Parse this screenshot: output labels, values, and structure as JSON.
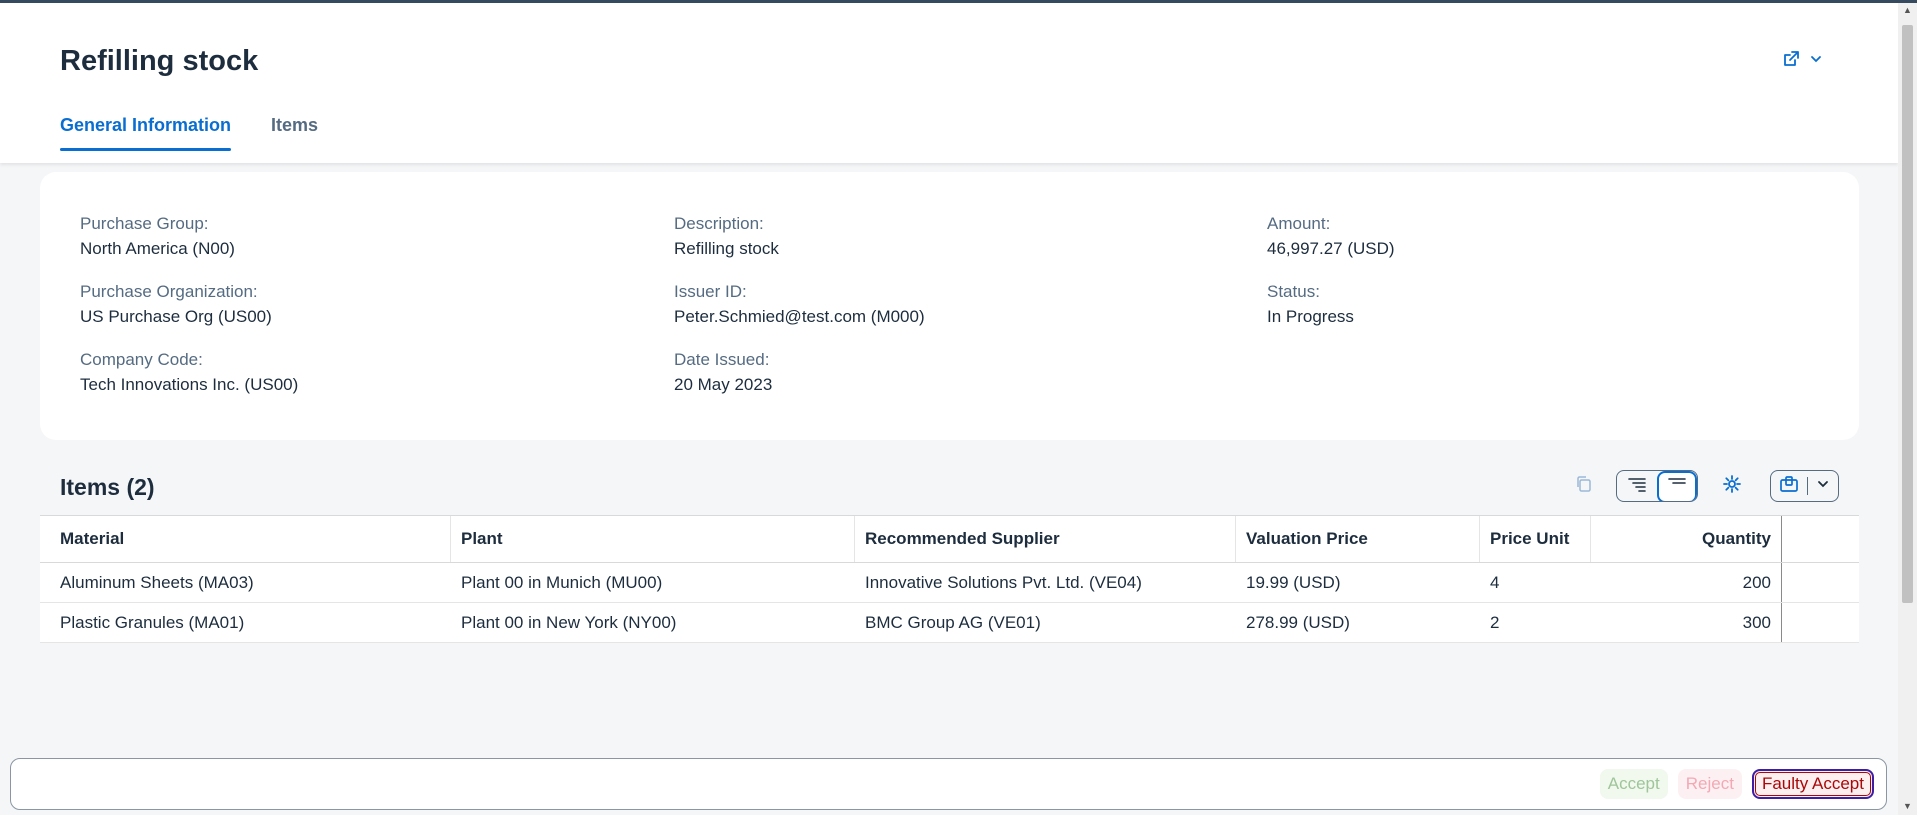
{
  "header": {
    "title": "Refilling stock",
    "tabs": [
      {
        "label": "General Information",
        "active": true
      },
      {
        "label": "Items",
        "active": false
      }
    ]
  },
  "info": {
    "col1": [
      {
        "label": "Purchase Group:",
        "value": "North America (N00)"
      },
      {
        "label": "Purchase Organization:",
        "value": "US Purchase Org (US00)"
      },
      {
        "label": "Company Code:",
        "value": "Tech Innovations Inc. (US00)"
      }
    ],
    "col2": [
      {
        "label": "Description:",
        "value": "Refilling stock"
      },
      {
        "label": "Issuer ID:",
        "value": "Peter.Schmied@test.com (M000)"
      },
      {
        "label": "Date Issued:",
        "value": "20 May 2023"
      }
    ],
    "col3": [
      {
        "label": "Amount:",
        "value": "46,997.27 (USD)"
      },
      {
        "label": "Status:",
        "value": "In Progress"
      }
    ]
  },
  "items": {
    "title": "Items (2)",
    "columns": [
      "Material",
      "Plant",
      "Recommended Supplier",
      "Valuation Price",
      "Price Unit",
      "Quantity"
    ],
    "rows": [
      [
        "Aluminum Sheets (MA03)",
        "Plant 00 in Munich (MU00)",
        "Innovative Solutions Pvt. Ltd. (VE04)",
        "19.99 (USD)",
        "4",
        "200"
      ],
      [
        "Plastic Granules (MA01)",
        "Plant 00 in New York (NY00)",
        "BMC Group AG (VE01)",
        "278.99 (USD)",
        "2",
        "300"
      ]
    ]
  },
  "footer": {
    "accept_label": "Accept",
    "reject_label": "Reject",
    "faulty_accept_label": "Faulty Accept"
  },
  "colors": {
    "accent": "#0a6ed1",
    "title": "#1d2d3e",
    "label": "#556b82"
  },
  "icons": [
    "share-icon",
    "chevron-down-icon",
    "copy-icon",
    "sort-ascending-icon",
    "sort-descending-icon",
    "settings-icon",
    "export-icon"
  ]
}
